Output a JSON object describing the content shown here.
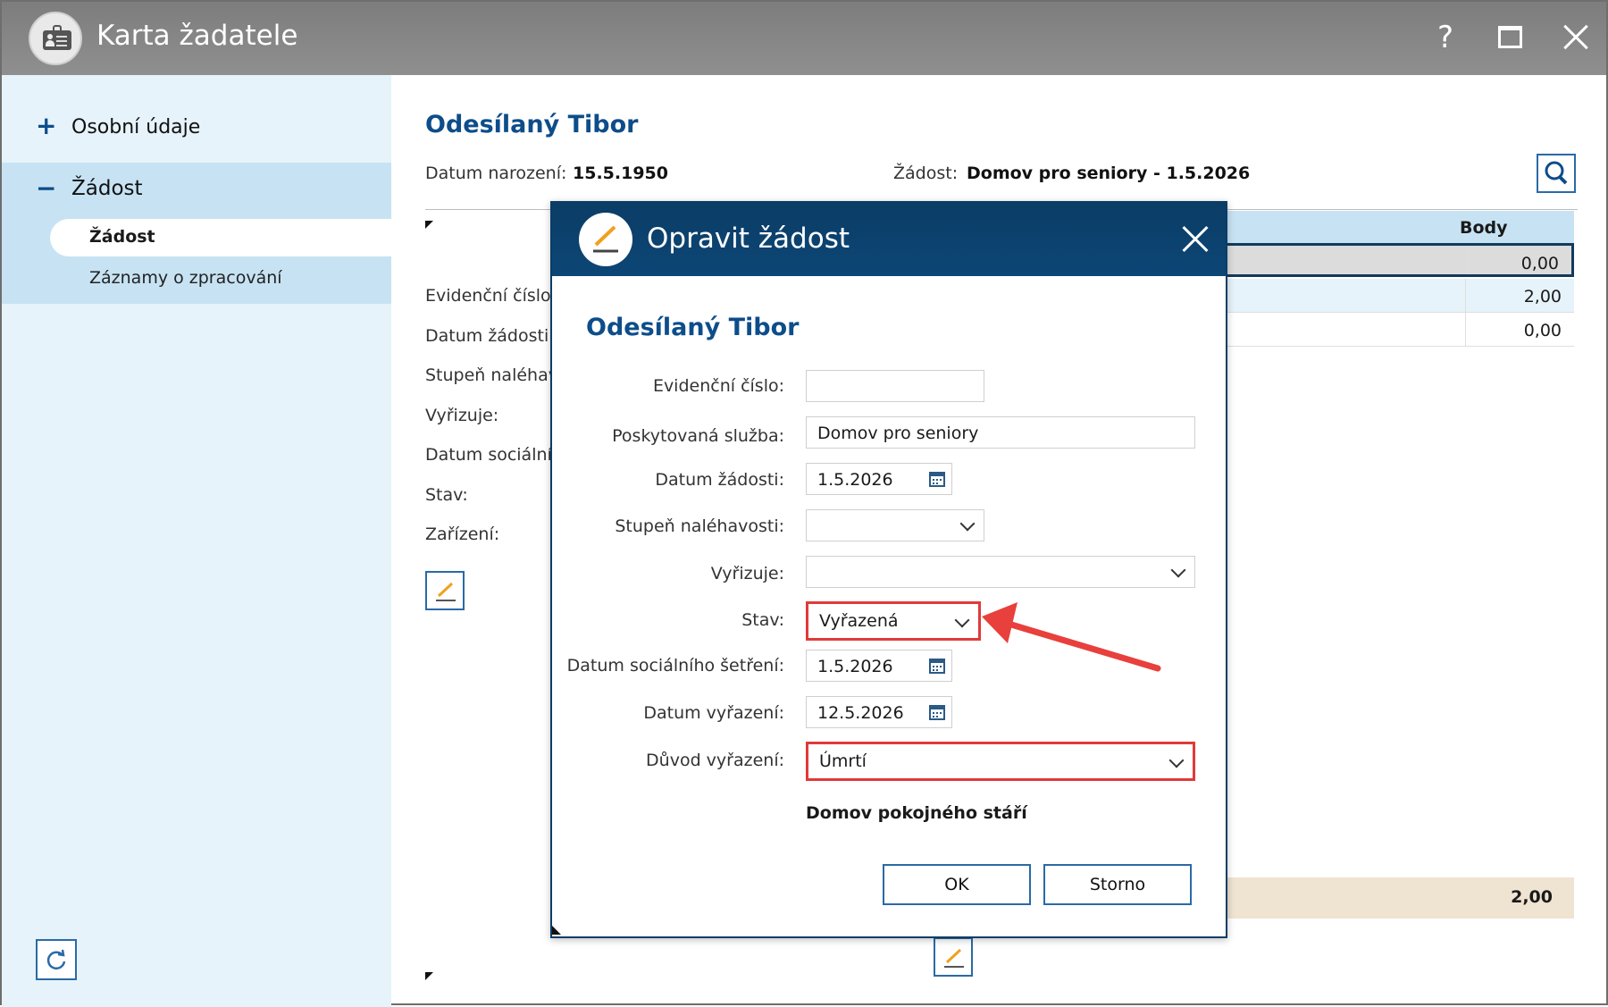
{
  "window": {
    "title": "Karta žadatele",
    "help_label": "?"
  },
  "sidebar": {
    "items": [
      {
        "symbol": "+",
        "label": "Osobní údaje"
      },
      {
        "symbol": "−",
        "label": "Žádost"
      }
    ],
    "subitems": [
      {
        "label": "Žádost"
      },
      {
        "label": "Záznamy o zpracování"
      }
    ]
  },
  "main": {
    "person_name": "Odesílaný Tibor",
    "birth_date_label": "Datum narození:",
    "birth_date": "15.5.1950",
    "request_label": "Žádost:",
    "request_value": "Domov pro seniory - 1.5.2026",
    "fields": [
      {
        "label": "Evidenční číslo:"
      },
      {
        "label": "Datum žádosti:"
      },
      {
        "label": "Stupeň naléhav"
      },
      {
        "label": "Vyřizuje:"
      },
      {
        "label": "Datum sociálníh"
      },
      {
        "label": "Stav:"
      },
      {
        "label": "Zařízení:"
      }
    ],
    "table": {
      "header": "Body",
      "rows": [
        {
          "value": "0,00"
        },
        {
          "value": "2,00"
        },
        {
          "value": "0,00"
        }
      ],
      "total": "2,00"
    }
  },
  "dialog": {
    "title": "Opravit žádost",
    "person_name": "Odesílaný Tibor",
    "fields": {
      "evidencni_cislo": {
        "label": "Evidenční číslo:",
        "value": ""
      },
      "poskytovana_sluzba": {
        "label": "Poskytovaná služba:",
        "value": "Domov pro seniory"
      },
      "datum_zadosti": {
        "label": "Datum žádosti:",
        "value": "1.5.2026"
      },
      "stupen_nalehavosti": {
        "label": "Stupeň naléhavosti:",
        "value": ""
      },
      "vyrizuje": {
        "label": "Vyřizuje:",
        "value": ""
      },
      "stav": {
        "label": "Stav:",
        "value": "Vyřazená"
      },
      "datum_socialniho_setreni": {
        "label": "Datum sociálního šetření:",
        "value": "1.5.2026"
      },
      "datum_vyrazeni": {
        "label": "Datum vyřazení:",
        "value": "12.5.2026"
      },
      "duvod_vyrazeni": {
        "label": "Důvod vyřazení:",
        "value": "Úmrtí"
      }
    },
    "organization": "Domov pokojného stáří",
    "ok_label": "OK",
    "cancel_label": "Storno"
  },
  "colors": {
    "title_bar": "#868686",
    "dialog_header": "#0b3d66",
    "accent": "#0d4d8a",
    "highlight": "#e03a3a"
  }
}
